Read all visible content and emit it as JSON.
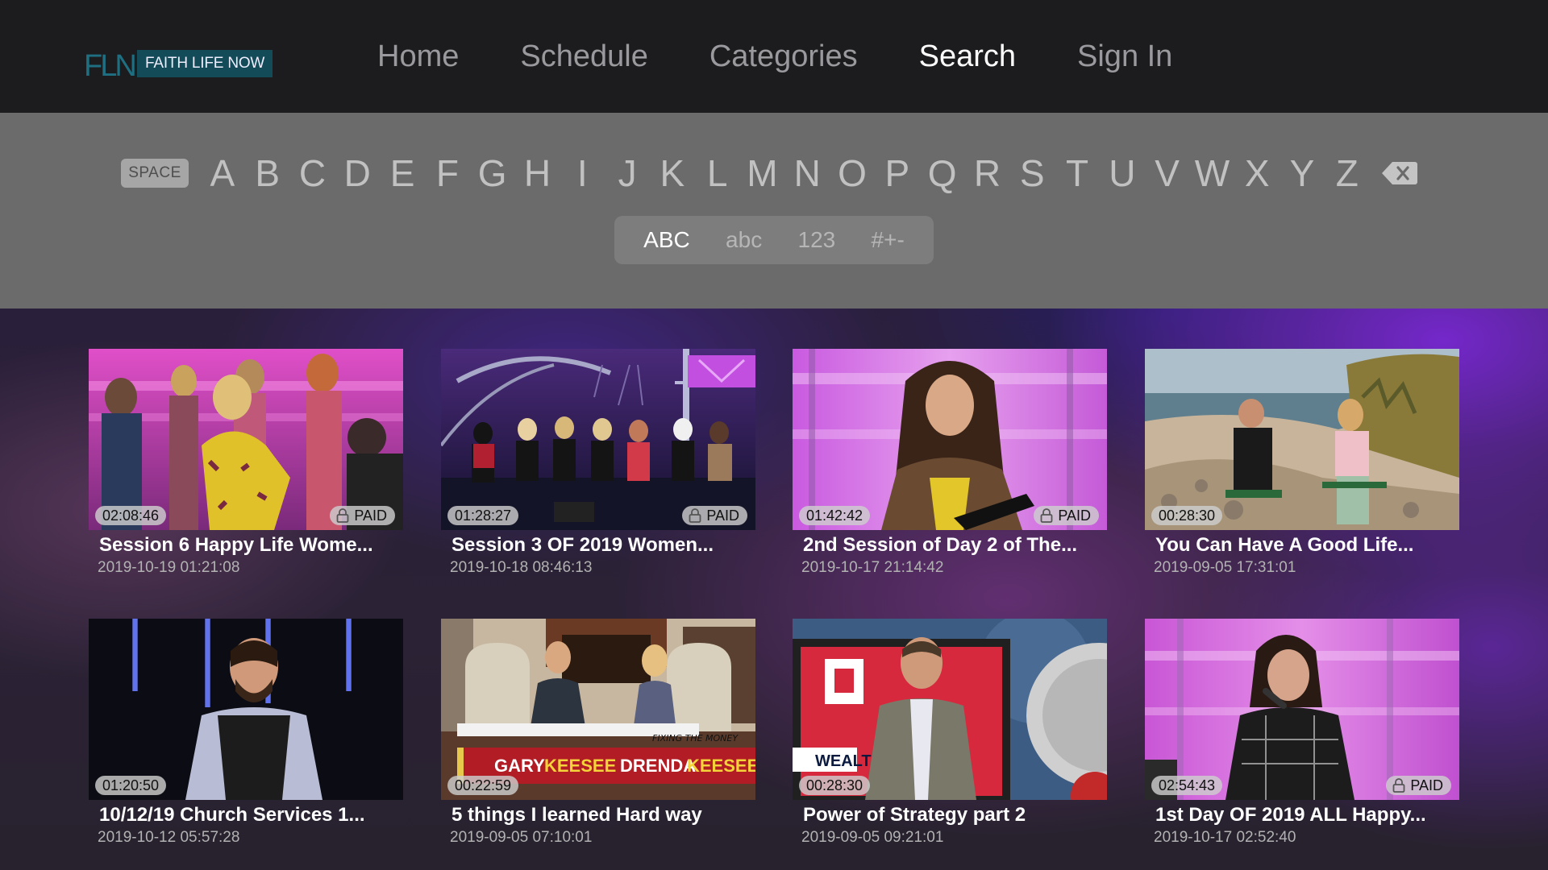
{
  "brand": {
    "logo_initials": "FLN",
    "logo_text": "FAITH LIFE NOW"
  },
  "nav": [
    {
      "label": "Home",
      "active": false
    },
    {
      "label": "Schedule",
      "active": false
    },
    {
      "label": "Categories",
      "active": false
    },
    {
      "label": "Search",
      "active": true
    },
    {
      "label": "Sign In",
      "active": false
    }
  ],
  "keyboard": {
    "space_label": "SPACE",
    "letters": [
      "A",
      "B",
      "C",
      "D",
      "E",
      "F",
      "G",
      "H",
      "I",
      "J",
      "K",
      "L",
      "M",
      "N",
      "O",
      "P",
      "Q",
      "R",
      "S",
      "T",
      "U",
      "V",
      "W",
      "X",
      "Y",
      "Z"
    ],
    "backspace_icon": "backspace-icon",
    "modes": [
      {
        "label": "ABC",
        "active": true
      },
      {
        "label": "abc",
        "active": false
      },
      {
        "label": "123",
        "active": false
      },
      {
        "label": "#+-",
        "active": false
      }
    ]
  },
  "paid_label": "PAID",
  "results": [
    {
      "title": "Session 6 Happy Life Wome...",
      "date": "2019-10-19 01:21:08",
      "duration": "02:08:46",
      "paid": true
    },
    {
      "title": "Session 3 OF 2019 Women...",
      "date": "2019-10-18 08:46:13",
      "duration": "01:28:27",
      "paid": true
    },
    {
      "title": "2nd Session of Day 2 of The...",
      "date": "2019-10-17 21:14:42",
      "duration": "01:42:42",
      "paid": true
    },
    {
      "title": "You Can Have A Good Life...",
      "date": "2019-09-05 17:31:01",
      "duration": "00:28:30",
      "paid": false
    },
    {
      "title": "10/12/19 Church Services 1...",
      "date": "2019-10-12 05:57:28",
      "duration": "01:20:50",
      "paid": false
    },
    {
      "title": "5 things I learned Hard way",
      "date": "2019-09-05 07:10:01",
      "duration": "00:22:59",
      "paid": false,
      "lower_third": [
        "GARY",
        "KEESEE",
        "DRENDA",
        "KEESEE"
      ],
      "lower_third_tag": "FIXING THE MONEY"
    },
    {
      "title": "Power of Strategy part 2",
      "date": "2019-09-05 09:21:01",
      "duration": "00:28:30",
      "paid": false,
      "screen_text": "WEALT"
    },
    {
      "title": "1st Day OF 2019 ALL Happy...",
      "date": "2019-10-17 02:52:40",
      "duration": "02:54:43",
      "paid": true
    }
  ]
}
